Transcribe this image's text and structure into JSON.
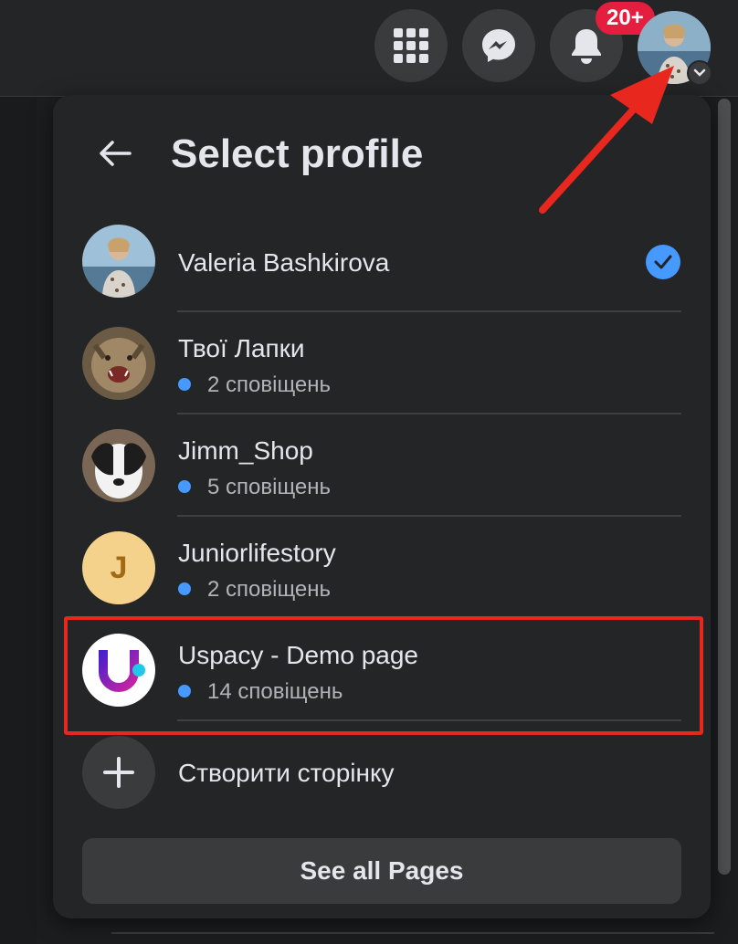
{
  "header": {
    "menu_icon": "grid-menu-icon",
    "messenger_icon": "messenger-icon",
    "notifications_icon": "bell-icon",
    "notifications_badge": "20+",
    "account_icon": "chevron-down-icon"
  },
  "panel": {
    "title": "Select profile",
    "back_icon": "arrow-left-icon",
    "profiles": [
      {
        "name": "Valeria Bashkirova",
        "selected": true
      },
      {
        "name": "Твої Лапки",
        "notifications": "2 сповіщень"
      },
      {
        "name": "Jimm_Shop",
        "notifications": "5 сповіщень"
      },
      {
        "name": "Juniorlifestory",
        "notifications": "2 сповіщень",
        "initial": "J"
      },
      {
        "name": "Uspacy - Demo page",
        "notifications": "14 сповіщень"
      }
    ],
    "create_page_label": "Створити сторінку",
    "see_all_label": "See all Pages"
  },
  "colors": {
    "accent_blue": "#4599ff",
    "badge_red": "#e41e3f",
    "annotation_red": "#e8281e",
    "panel_bg": "#242526"
  }
}
